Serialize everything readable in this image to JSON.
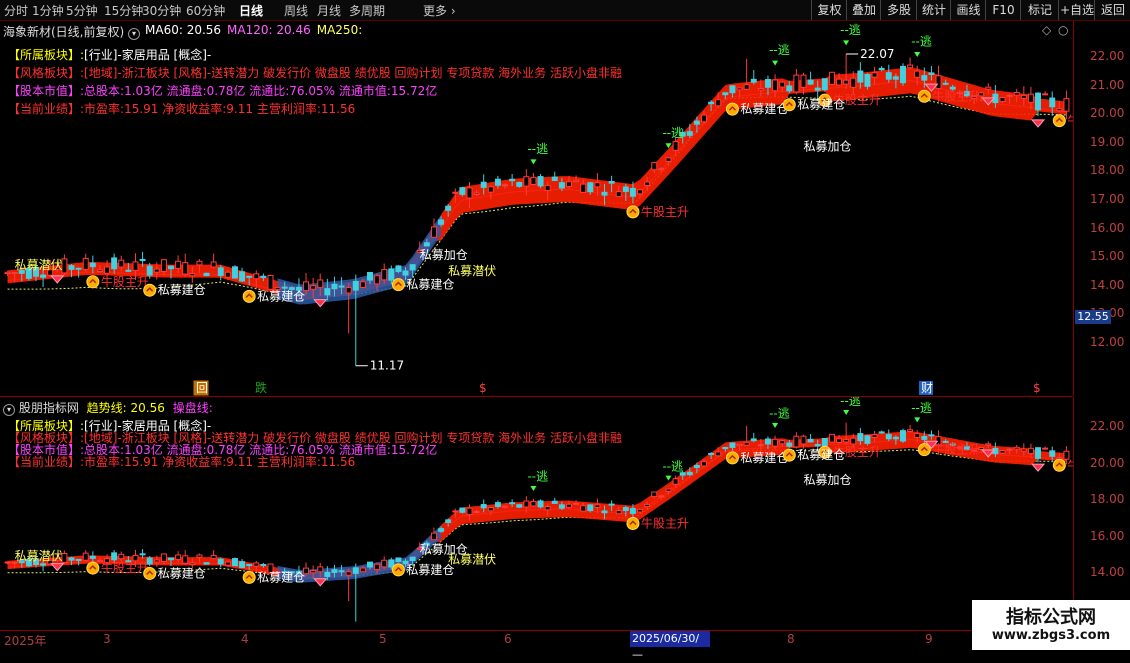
{
  "toolbar": {
    "periods": [
      "分时",
      "1分钟",
      "5分钟",
      "15分钟",
      "30分钟",
      "60分钟",
      "日线",
      "周线",
      "月线",
      "多周期",
      "更多"
    ],
    "active_period": "日线",
    "right_buttons": [
      "复权",
      "叠加",
      "多股",
      "统计",
      "画线",
      "F10",
      "标记",
      "+自选",
      "返回"
    ]
  },
  "main_pane": {
    "stock_title": "海象新材(日线,前复权)",
    "ma_labels": [
      {
        "text": "MA60: 20.56",
        "color": "#ffffff"
      },
      {
        "text": "MA120: 20.46",
        "color": "#ff66ff"
      },
      {
        "text": "MA250:",
        "color": "#ffff66"
      }
    ],
    "info_lines": [
      {
        "label": "【所属板块】:",
        "value": "[行业]-家居用品 [概念]-",
        "lc": "#ffff00",
        "vc": "#ffffff"
      },
      {
        "label": "【风格板块】:",
        "value": "[地域]-浙江板块 [风格]-送转潜力 破发行价 微盘股 绩优股 回购计划 专项贷款 海外业务 活跃小盘非融",
        "lc": "#ff3030",
        "vc": "#ff3030"
      },
      {
        "label": "【股本市值】:",
        "value": "总股本:1.03亿 流通盘:0.78亿 流通比:76.05% 流通市值:15.72亿",
        "lc": "#ff40ff",
        "vc": "#ff40ff"
      },
      {
        "label": "【当前业绩】:",
        "value": "市盈率:15.91 净资收益率:9.11 主营利润率:11.56",
        "lc": "#ff3030",
        "vc": "#ff3030"
      }
    ],
    "high_label": "22.07",
    "low_label": "11.17",
    "current_price": "12.55",
    "y_ticks": [
      "22.00",
      "21.00",
      "20.00",
      "19.00",
      "18.00",
      "17.00",
      "16.00",
      "15.00",
      "14.00",
      "13.00",
      "12.00"
    ],
    "bottom_markers": [
      "回",
      "跌",
      "$",
      "财",
      "$"
    ]
  },
  "sub_pane": {
    "title": "股朋指标网",
    "trend_label": "趋势线: 20.56",
    "operate_label": "操盘线:",
    "info_lines": [
      {
        "label": "【所属板块】:",
        "value": "[行业]-家居用品 [概念]-",
        "lc": "#ffff00",
        "vc": "#ffffff"
      },
      {
        "label": "【风格板块】:",
        "value": "[地域]-浙江板块 [风格]-送转潜力 破发行价 微盘股 绩优股 回购计划 专项贷款 海外业务 活跃小盘非融",
        "lc": "#ff3030",
        "vc": "#ff3030"
      },
      {
        "label": "【股本市值】:",
        "value": "总股本:1.03亿 流通盘:0.78亿 流通比:76.05% 流通市值:15.72亿",
        "lc": "#ff40ff",
        "vc": "#ff40ff"
      },
      {
        "label": "【当前业绩】:",
        "value": "市盈率:15.91 净资收益率:9.11 主营利润率:11.56",
        "lc": "#ff3030",
        "vc": "#ff3030"
      }
    ],
    "y_ticks": [
      "22.00",
      "20.00",
      "18.00",
      "16.00",
      "14.00"
    ]
  },
  "annotations": {
    "escape": "--逃",
    "bull_main": "牛股主升",
    "private_build": "私募建仓",
    "private_add": "私募加仓",
    "private_lurk": "私募潜伏"
  },
  "x_axis": {
    "labels": [
      "2025年",
      "3",
      "4",
      "5",
      "6",
      "7",
      "8",
      "9"
    ],
    "cursor_date": "2025/06/30/—"
  },
  "watermark": {
    "title": "指标公式网",
    "url": "www.zbgs3.com"
  }
}
